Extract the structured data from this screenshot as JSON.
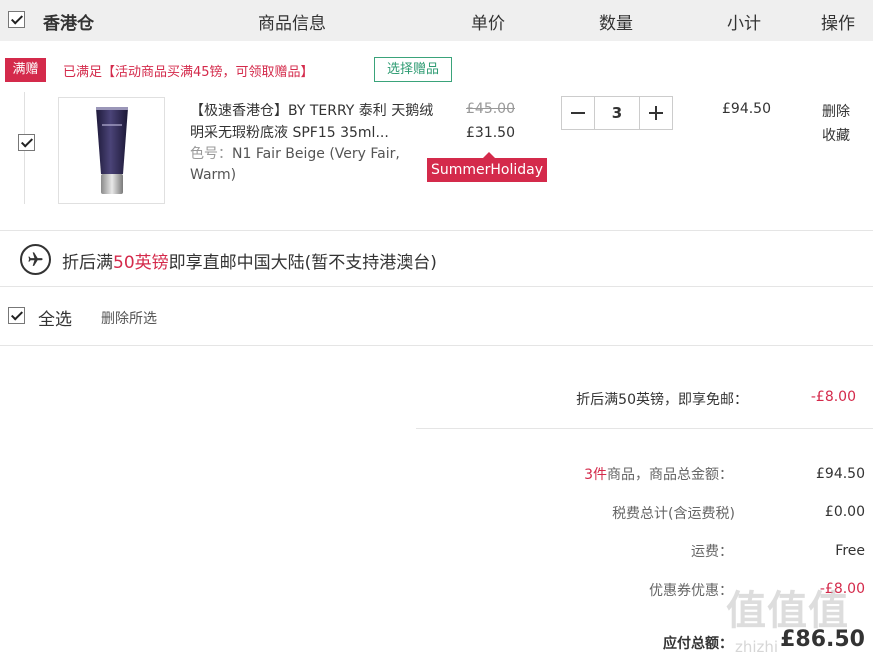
{
  "header": {
    "store": "香港仓",
    "col_info": "商品信息",
    "col_price": "单价",
    "col_qty": "数量",
    "col_subtotal": "小计",
    "col_action": "操作"
  },
  "promo": {
    "tag": "满赠",
    "text": "已满足【活动商品买满45镑，可领取赠品】",
    "gift_button": "选择赠品"
  },
  "item": {
    "name": "【极速香港仓】BY TERRY 泰利 天鹅绒明采无瑕粉底液 SPF15 35ml...",
    "variant_label": "色号：",
    "variant_value": "N1 Fair Beige (Very Fair, Warm)",
    "old_price": "£45.00",
    "new_price": "£31.50",
    "coupon": "SummerHoliday",
    "quantity": "3",
    "subtotal": "£94.50",
    "delete": "删除",
    "favorite": "收藏"
  },
  "shipping": {
    "prefix": "折后满",
    "highlight": "50英镑",
    "suffix": "即享直邮中国大陆(暂不支持港澳台)"
  },
  "footer": {
    "select_all": "全选",
    "delete_selected": "删除所选"
  },
  "summary": {
    "free_ship_label": "折后满50英镑，即享免邮：",
    "free_ship_value": "-£8.00",
    "count_prefix": "3件",
    "count_label": "商品，商品总金额：",
    "goods_total": "£94.50",
    "tax_label": "税费总计(含运费税)",
    "tax_value": "£0.00",
    "freight_label": "运费：",
    "freight_value": "Free",
    "coupon_label": "优惠券优惠：",
    "coupon_value": "-£8.00",
    "payable_label": "应付总额：",
    "payable_value": "£86.50"
  },
  "watermark": {
    "logo": "值值值",
    "site": "zhizhi"
  },
  "colors": {
    "accent": "#d42a4b",
    "green": "#2d9b72",
    "header_bg": "#efefef"
  }
}
